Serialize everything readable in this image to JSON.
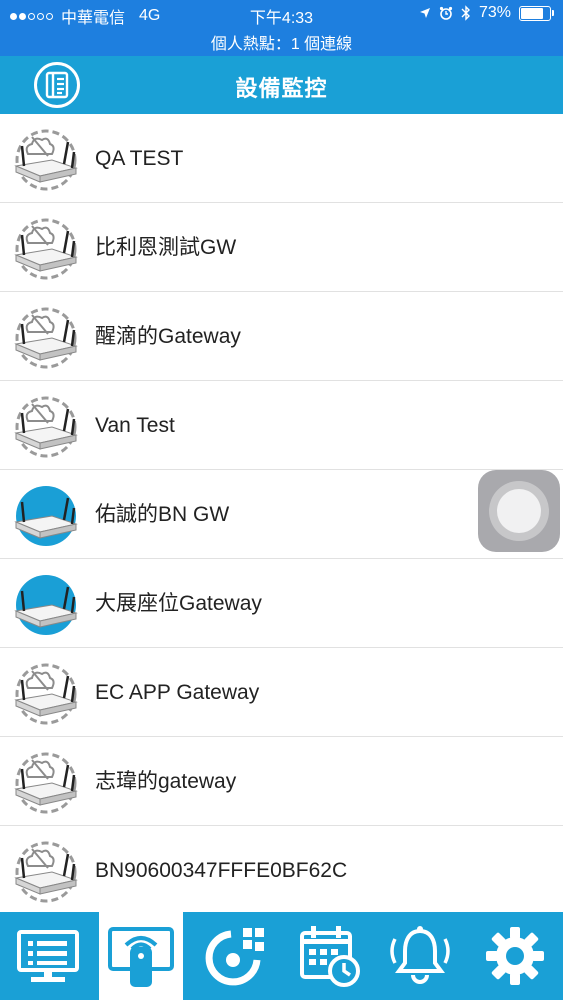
{
  "status_bar": {
    "carrier": "中華電信",
    "network": "4G",
    "time": "下午4:33",
    "battery": "73%",
    "hotspot": "個人熱點：1 個連線"
  },
  "nav": {
    "title": "設備監控",
    "menu_icon": "device-list-icon"
  },
  "devices": [
    {
      "name": "QA TEST",
      "online": false
    },
    {
      "name": "比利恩測試GW",
      "online": false
    },
    {
      "name": "醒滴的Gateway",
      "online": false
    },
    {
      "name": "Van Test",
      "online": false
    },
    {
      "name": "佑誠的BN GW",
      "online": true
    },
    {
      "name": "大展座位Gateway",
      "online": true
    },
    {
      "name": "EC APP Gateway",
      "online": false
    },
    {
      "name": "志瑋的gateway",
      "online": false
    },
    {
      "name": "BN90600347FFFE0BF62C",
      "online": false
    }
  ],
  "tabs": [
    {
      "icon": "monitor-icon",
      "active": false
    },
    {
      "icon": "remote-control-icon",
      "active": true
    },
    {
      "icon": "scene-icon",
      "active": false
    },
    {
      "icon": "schedule-icon",
      "active": false
    },
    {
      "icon": "alarm-bell-icon",
      "active": false
    },
    {
      "icon": "settings-gear-icon",
      "active": false
    }
  ],
  "colors": {
    "status_bar": "#1e7fdf",
    "nav_bar": "#1aa0d6",
    "online_circle": "#1a9fd6"
  }
}
